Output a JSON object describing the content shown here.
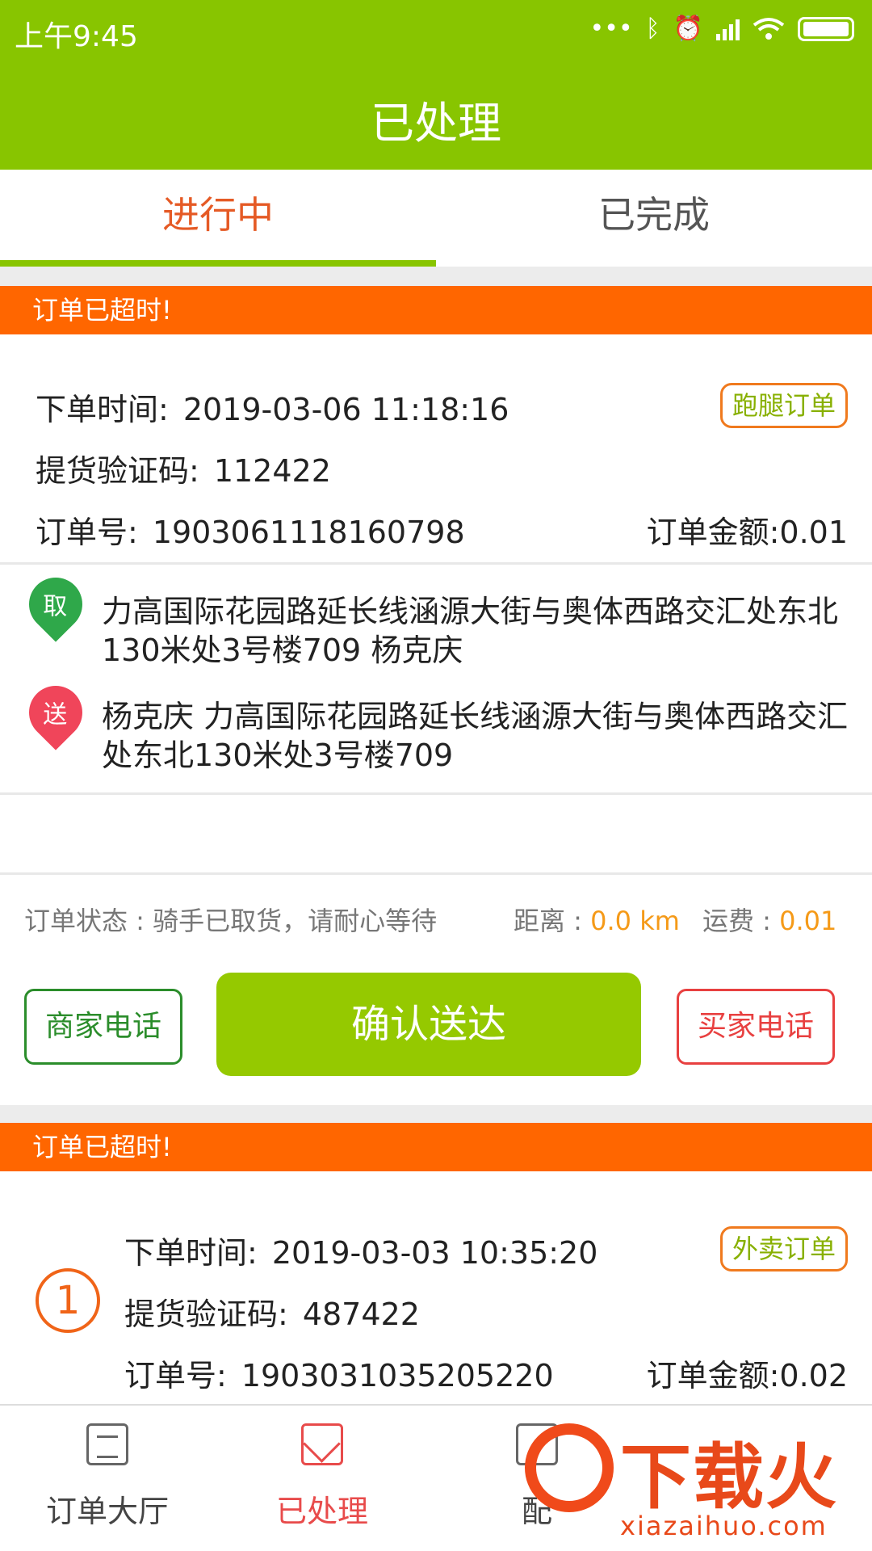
{
  "status_bar": {
    "time": "上午9:45",
    "icons": [
      "dots-icon",
      "bluetooth-icon",
      "alarm-icon",
      "signal-icon",
      "wifi-icon",
      "battery-icon"
    ]
  },
  "header": {
    "title": "已处理"
  },
  "tabs": [
    {
      "label": "进行中",
      "active": true
    },
    {
      "label": "已完成",
      "active": false
    }
  ],
  "orders": [
    {
      "banner": "订单已超时!",
      "order_time_label": "下单时间:",
      "order_time": "2019-03-06 11:18:16",
      "type_tag": "跑腿订单",
      "code_label": "提货验证码:",
      "code": "112422",
      "order_no_label": "订单号:",
      "order_no": "1903061118160798",
      "amount_label": "订单金额:",
      "amount": "0.01",
      "pickup_badge": "取",
      "pickup_address": "力高国际花园路延长线涵源大街与奥体西路交汇处东北130米处3号楼709 杨克庆",
      "delivery_badge": "送",
      "delivery_address": "杨克庆 力高国际花园路延长线涵源大街与奥体西路交汇处东北130米处3号楼709",
      "status_text": "订单状态 : 骑手已取货，请耐心等待",
      "distance_label": "距离 :",
      "distance": "0.0 km",
      "fee_label": "运费 :",
      "fee": "0.01",
      "merchant_phone": "商家电话",
      "confirm": "确认送达",
      "buyer_phone": "买家电话"
    },
    {
      "banner": "订单已超时!",
      "index": "1",
      "order_time_label": "下单时间:",
      "order_time": "2019-03-03 10:35:20",
      "type_tag": "外卖订单",
      "code_label": "提货验证码:",
      "code": "487422",
      "order_no_label": "订单号:",
      "order_no": "1903031035205220",
      "amount_label": "订单金额:",
      "amount": "0.02"
    }
  ],
  "bottom_nav": [
    {
      "label": "订单大厅",
      "icon": "list-icon"
    },
    {
      "label": "已处理",
      "icon": "mail-icon",
      "active": true
    },
    {
      "label": "配",
      "icon": "delivery-icon"
    }
  ],
  "watermark": {
    "text": "下载火",
    "url": "xiazaihuo.com"
  },
  "colors": {
    "brand": "#88c500",
    "banner": "#ff6600",
    "accent": "#f59a18",
    "active_tab": "#e55a25"
  }
}
